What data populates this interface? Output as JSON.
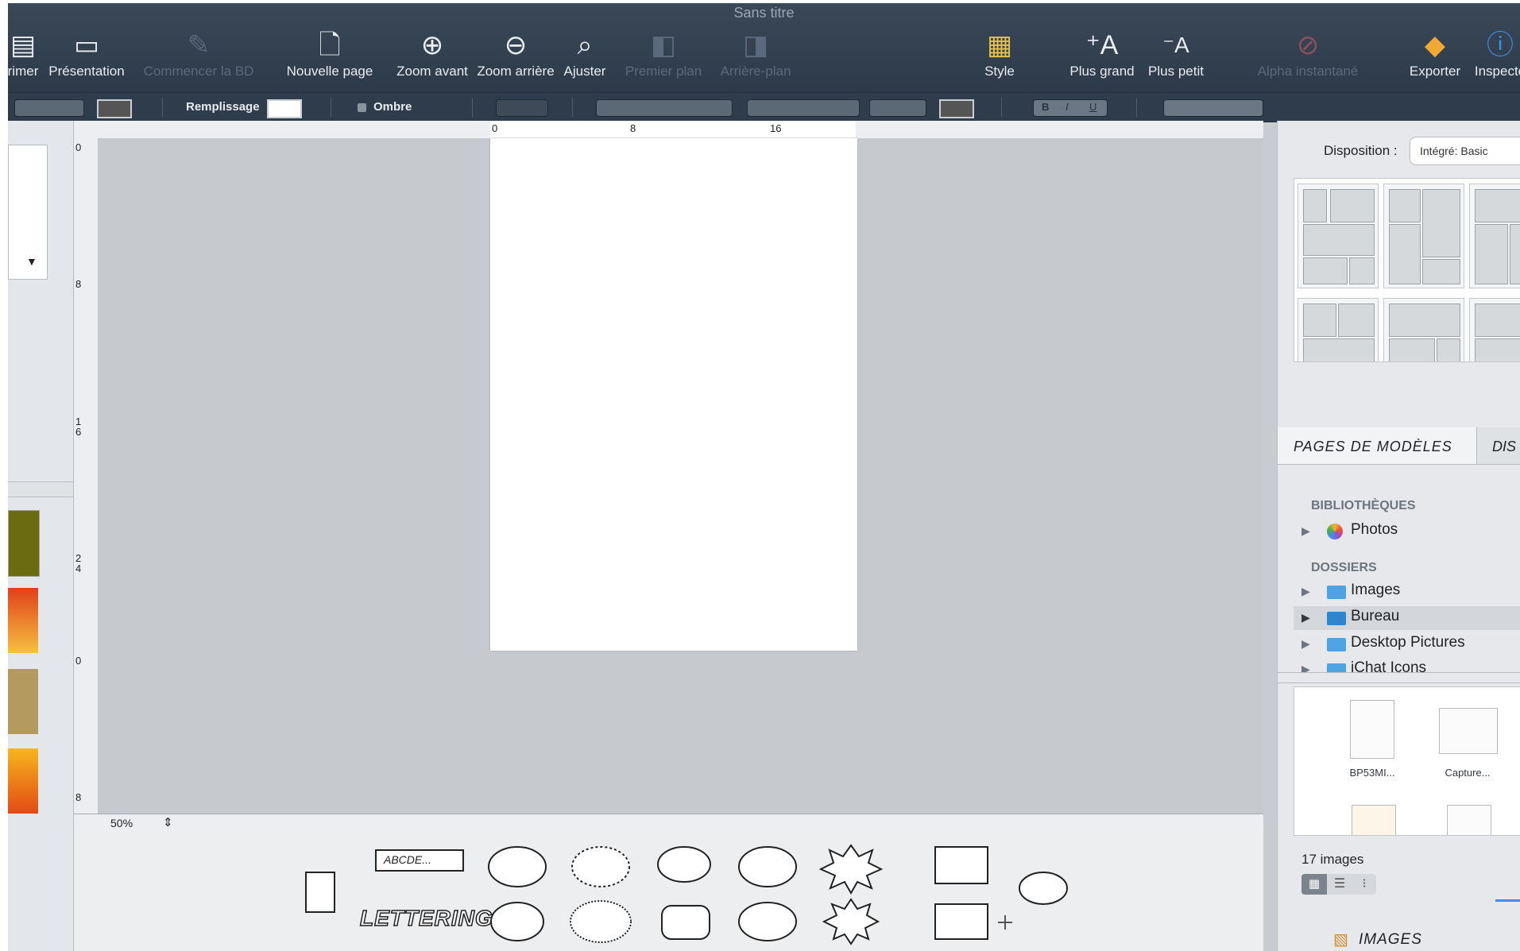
{
  "window": {
    "title": "Sans titre"
  },
  "toolbar": {
    "items": [
      {
        "label": "rimer",
        "icon": "print-icon",
        "enabled": true
      },
      {
        "label": "Présentation",
        "icon": "presentation-icon",
        "enabled": true
      },
      {
        "label": "Commencer la BD",
        "icon": "pen-icon",
        "enabled": false
      },
      {
        "label": "Nouvelle page",
        "icon": "new-page-icon",
        "enabled": true
      },
      {
        "label": "Zoom avant",
        "icon": "zoom-in-icon",
        "enabled": true
      },
      {
        "label": "Zoom arrière",
        "icon": "zoom-out-icon",
        "enabled": true
      },
      {
        "label": "Ajuster",
        "icon": "zoom-fit-icon",
        "enabled": true
      },
      {
        "label": "Premier plan",
        "icon": "bring-front-icon",
        "enabled": false
      },
      {
        "label": "Arrière-plan",
        "icon": "send-back-icon",
        "enabled": false
      },
      {
        "label": "Style",
        "icon": "style-icon",
        "enabled": true
      },
      {
        "label": "Plus grand",
        "icon": "font-bigger-icon",
        "enabled": true
      },
      {
        "label": "Plus petit",
        "icon": "font-smaller-icon",
        "enabled": true
      },
      {
        "label": "Alpha instantané",
        "icon": "instant-alpha-icon",
        "enabled": false
      },
      {
        "label": "Exporter",
        "icon": "export-icon",
        "enabled": true
      },
      {
        "label": "Inspecte",
        "icon": "info-icon",
        "enabled": true
      }
    ]
  },
  "format_bar": {
    "fill_label": "Remplissage",
    "shadow_label": "Ombre",
    "bold": "B",
    "italic": "I",
    "underline": "U"
  },
  "ruler": {
    "h_ticks": [
      "0",
      "8",
      "16"
    ],
    "v_ticks": [
      "0",
      "8",
      "1\n6",
      "2\n4",
      "0",
      "8"
    ]
  },
  "status": {
    "zoom": "50%"
  },
  "tray": {
    "text_box_label": "ABCDE...",
    "lettering_label": "LETTERING"
  },
  "right_panel": {
    "layout_label": "Disposition :",
    "layout_value": "Intégré: Basic",
    "tabs": [
      "PAGES DE MODÈLES",
      "DIS"
    ],
    "libraries_heading": "BIBLIOTHÈQUES",
    "libraries": [
      {
        "label": "Photos"
      }
    ],
    "folders_heading": "DOSSIERS",
    "folders": [
      {
        "label": "Images",
        "selected": false
      },
      {
        "label": "Bureau",
        "selected": true
      },
      {
        "label": "Desktop Pictures",
        "selected": false
      },
      {
        "label": "iChat Icons",
        "selected": false
      }
    ],
    "images": [
      {
        "caption": "BP53MI..."
      },
      {
        "caption": "Capture..."
      },
      {
        "caption": ""
      },
      {
        "caption": ""
      }
    ],
    "image_count": "17 images",
    "bottom_tab": "IMAGES"
  },
  "colors": {
    "toolbar_bg": "#34424f",
    "canvas_bg": "#c6cacf",
    "accent": "#4fa3e0"
  }
}
